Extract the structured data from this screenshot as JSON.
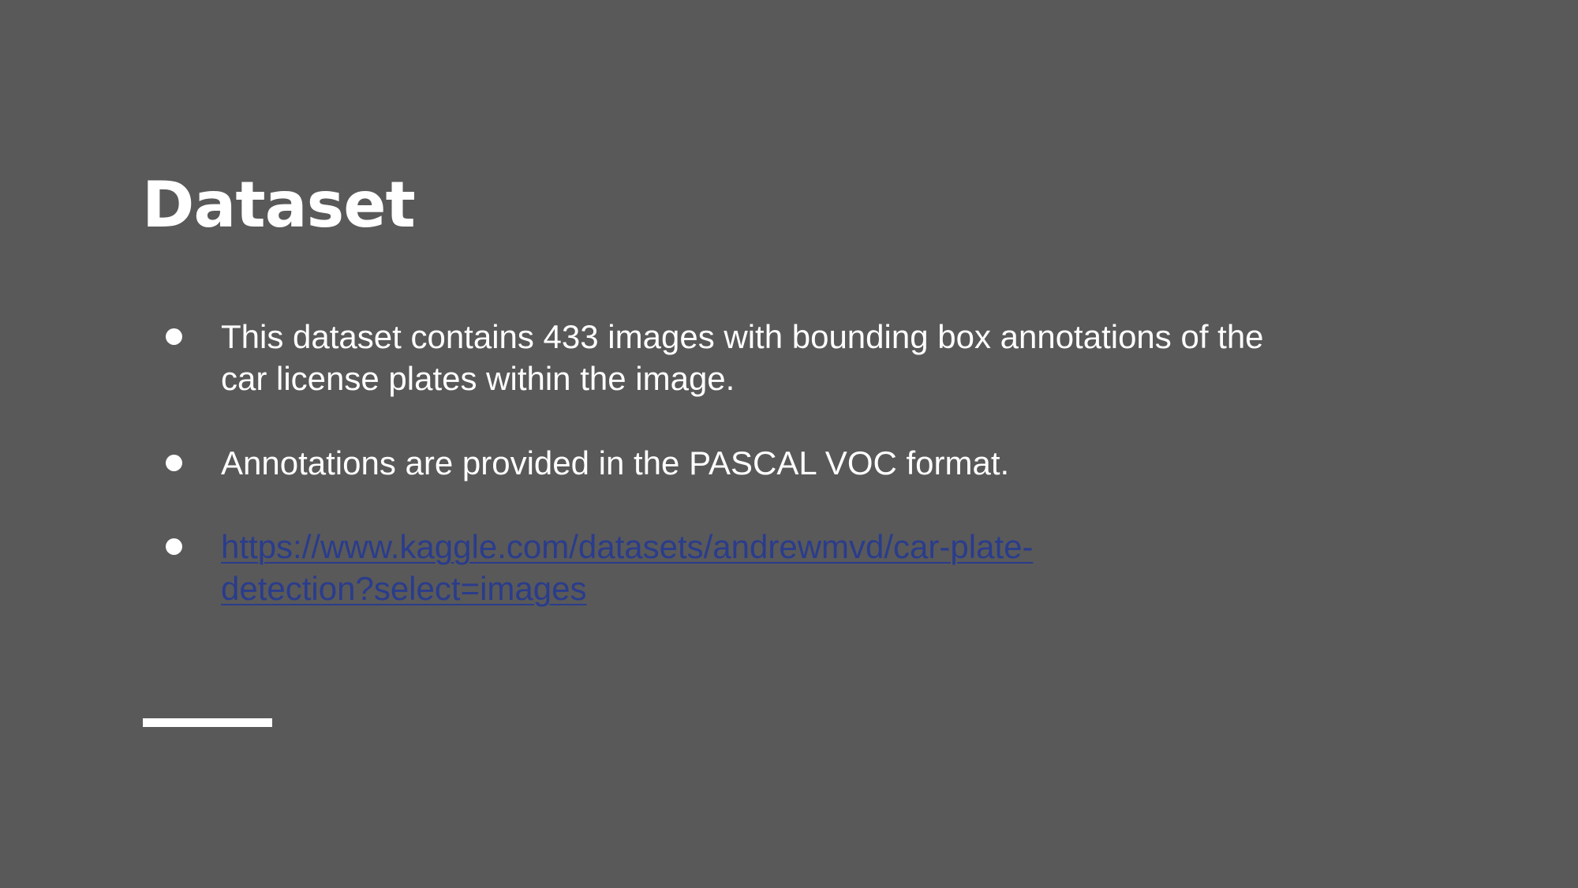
{
  "slide": {
    "title": "Dataset",
    "bullets": [
      {
        "text_line_1": "This dataset contains 433 images with bounding box annotations of the",
        "text_line_2": "car license plates within the image."
      },
      {
        "text": "Annotations are provided in the PASCAL VOC format."
      },
      {
        "link_line_1": "https://www.kaggle.com/datasets/andrewmvd/car-plate-",
        "link_line_2": "detection?select=images",
        "href": "https://www.kaggle.com/datasets/andrewmvd/car-plate-detection?select=images"
      }
    ]
  },
  "colors": {
    "background": "#595959",
    "text": "#ffffff",
    "link": "#2a3c8c",
    "accent_bar": "#ffffff"
  }
}
